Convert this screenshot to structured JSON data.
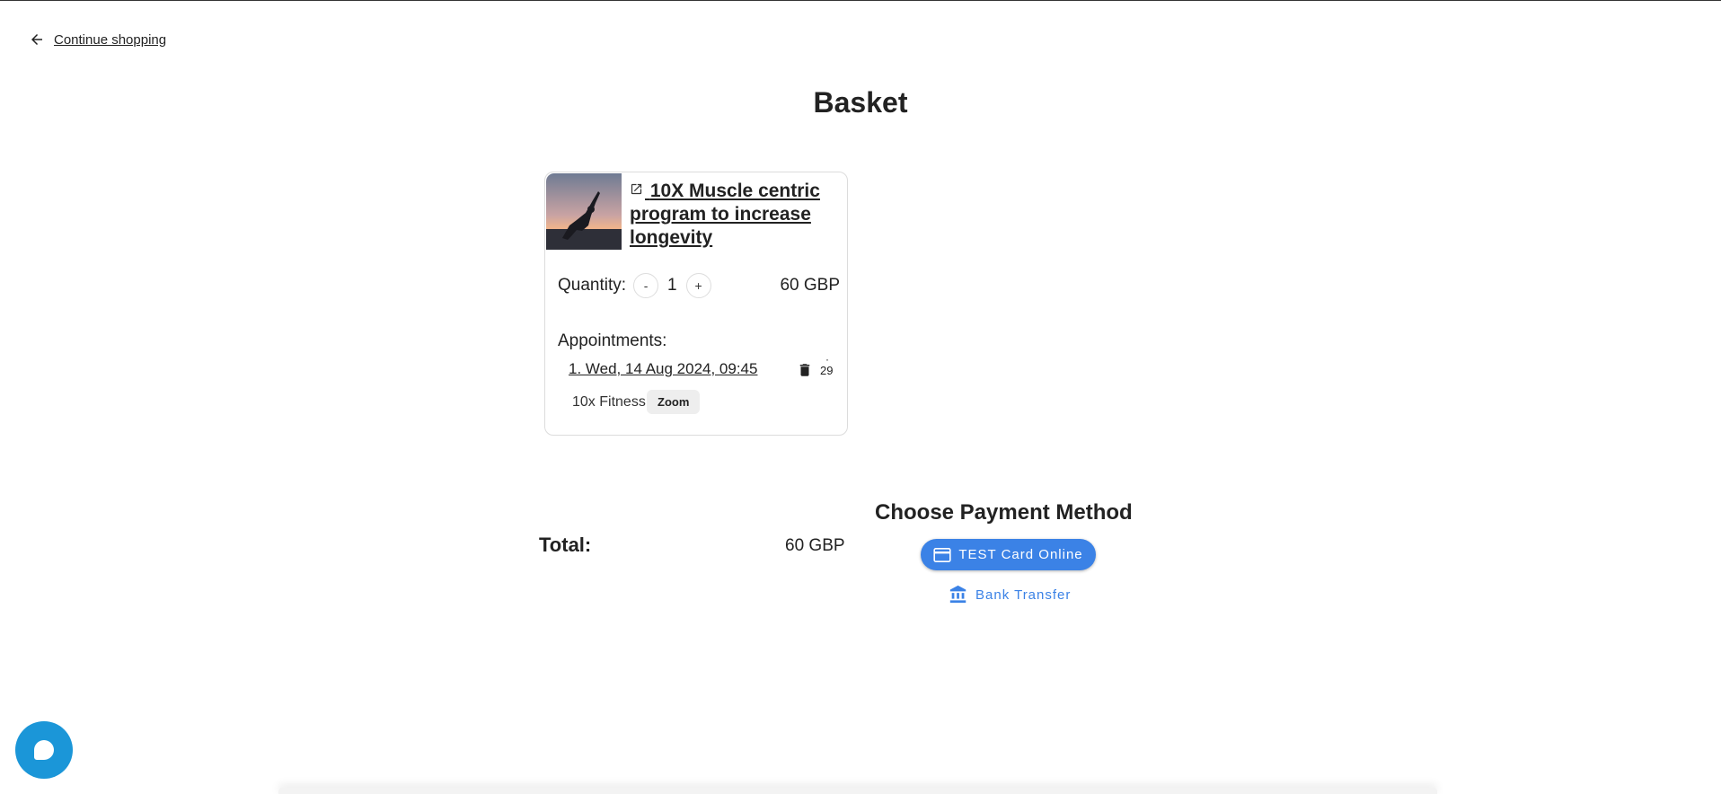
{
  "nav": {
    "back_label": "Continue shopping"
  },
  "page": {
    "title": "Basket"
  },
  "item": {
    "title": "10X Muscle centric program to increase longevity",
    "quantity_label": "Quantity:",
    "decrement_label": "-",
    "increment_label": "+",
    "quantity": "1",
    "price": "60 GBP",
    "appointments_label": "Appointments:",
    "appointment": "1. Wed, 14 Aug 2024, 09:45",
    "appointment_count": "29",
    "organization": "10x Fitness",
    "location_chip": "Zoom"
  },
  "summary": {
    "total_label": "Total:",
    "total_value": "60 GBP"
  },
  "payment": {
    "title": "Choose Payment Method",
    "card_option": "TEST Card Online",
    "bank_option": "Bank Transfer"
  },
  "colors": {
    "accent": "#3b82e6",
    "chat": "#1b96d8"
  },
  "icons": [
    "arrow-left-icon",
    "external-link-icon",
    "trash-icon",
    "credit-card-icon",
    "bank-icon",
    "chat-icon"
  ]
}
